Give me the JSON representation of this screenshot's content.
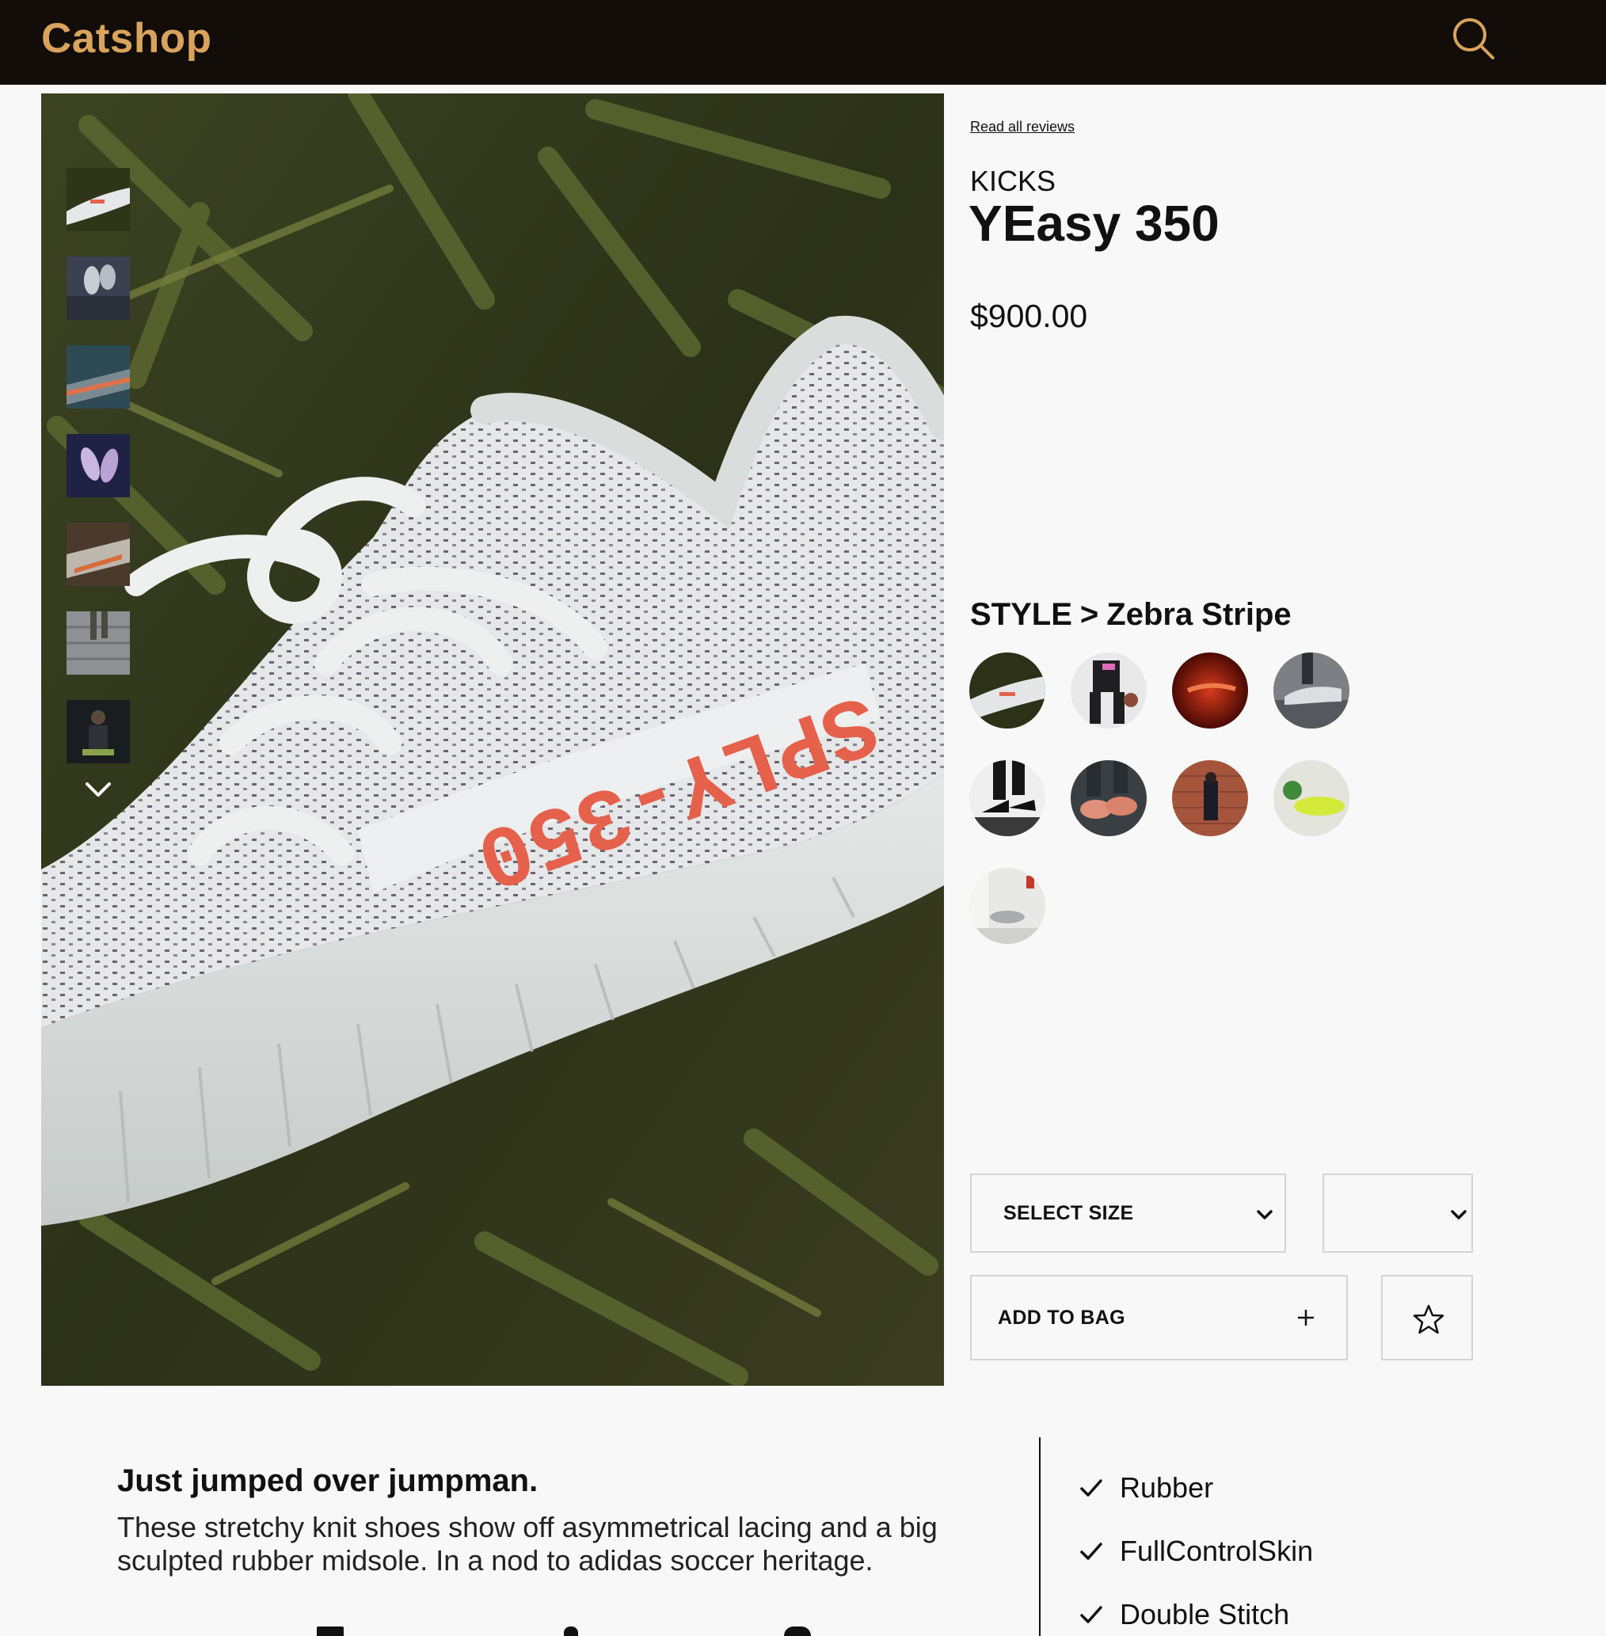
{
  "header": {
    "logo": "Catshop",
    "search_icon": "search-icon",
    "logo_color": "#d9a35d",
    "background_color": "#120d08"
  },
  "gallery": {
    "main_image": "sneaker-on-ferns-image",
    "thumbnails": [
      "thumb-sneaker-ferns",
      "thumb-sneakers-pair-dark",
      "thumb-sneakers-orange-stripe",
      "thumb-sneakers-purple",
      "thumb-sneakers-rocks",
      "thumb-legs-stairs",
      "thumb-person-sitting"
    ],
    "scroll_down_icon": "chevron-down-icon"
  },
  "product": {
    "reviews_link": "Read all reviews",
    "brand": "KICKS",
    "name": "YEasy 350",
    "price": "$900.00",
    "style_prefix": "STYLE",
    "style_separator": ">",
    "style_name": "Zebra Stripe",
    "swatches": [
      "zebra-stripe",
      "black-pink",
      "red-glow",
      "grey-street",
      "black-boots",
      "orange-pair",
      "brick-wall",
      "yellow-green",
      "grey-room"
    ]
  },
  "actions": {
    "select_size_label": "SELECT SIZE",
    "quantity_value": "",
    "add_to_bag_label": "ADD TO BAG",
    "add_icon": "plus-icon",
    "favorite_icon": "star-icon"
  },
  "description": {
    "title": "Just jumped over jumpman.",
    "text": "These stretchy knit shoes show off asymmetrical lacing and a big sculpted rubber midsole. In a nod to adidas soccer heritage.",
    "features": [
      "Rubber",
      "FullControlSkin",
      "Double Stitch"
    ]
  }
}
